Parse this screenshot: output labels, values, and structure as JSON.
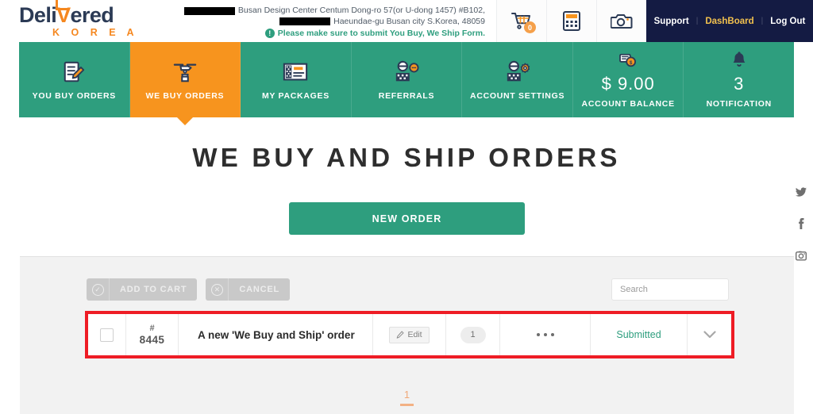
{
  "header": {
    "logo": {
      "text_before": "Deli",
      "text_v": "V",
      "text_after": "ered",
      "subtitle": "K O R E A"
    },
    "address": {
      "line1": "Busan Design Center Centum Dong-ro 57(or U-dong 1457) #B102,",
      "line2": "Haeundae-gu Busan city S.Korea, 48059",
      "notice": "Please make sure to submit You Buy, We Ship Form.",
      "notice_icon": "exclamation-circle-icon"
    },
    "icons": [
      {
        "name": "shopping-cart-icon",
        "badge": "0"
      },
      {
        "name": "calculator-icon",
        "badge": null
      },
      {
        "name": "camera-icon",
        "badge": null
      }
    ],
    "links": [
      {
        "label": "Support",
        "accent": false
      },
      {
        "label": "DashBoard",
        "accent": true
      },
      {
        "label": "Log Out",
        "accent": false
      }
    ],
    "link_separator": "|"
  },
  "nav": {
    "tabs": [
      {
        "label": "YOU BUY ORDERS",
        "icon": "document-pencil-icon",
        "active": false,
        "value": null
      },
      {
        "label": "WE BUY ORDERS",
        "icon": "drone-delivery-icon",
        "active": true,
        "value": null
      },
      {
        "label": "MY PACKAGES",
        "icon": "package-box-icon",
        "active": false,
        "value": null
      },
      {
        "label": "REFERRALS",
        "icon": "person-chat-icon",
        "active": false,
        "value": null
      },
      {
        "label": "ACCOUNT SETTINGS",
        "icon": "person-gear-icon",
        "active": false,
        "value": null
      },
      {
        "label": "ACCOUNT BALANCE",
        "icon": "money-coin-icon",
        "active": false,
        "value": "$ 9.00"
      },
      {
        "label": "NOTIFICATION",
        "icon": "bell-icon",
        "active": false,
        "value": "3"
      }
    ]
  },
  "main": {
    "title": "WE BUY AND SHIP ORDERS",
    "new_order_label": "NEW ORDER",
    "toolbar": {
      "add_to_cart_label": "ADD TO CART",
      "add_to_cart_icon": "check-circle-icon",
      "cancel_label": "CANCEL",
      "cancel_icon": "x-circle-icon"
    },
    "search": {
      "placeholder": "Search",
      "value": "",
      "icon": "search-icon"
    },
    "order_row": {
      "hash_symbol": "#",
      "order_number": "8445",
      "title": "A new 'We Buy and Ship' order",
      "edit_label": "Edit",
      "edit_icon": "pencil-icon",
      "quantity": "1",
      "more_icon": "three-dots-icon",
      "status": "Submitted",
      "expand_icon": "chevron-down-icon"
    },
    "pagination": {
      "current": "1"
    }
  },
  "social": [
    {
      "name": "twitter-icon",
      "glyph": "🐦"
    },
    {
      "name": "facebook-icon",
      "glyph": "f"
    },
    {
      "name": "instagram-icon",
      "glyph": "▣"
    }
  ],
  "colors": {
    "green": "#2e9e7e",
    "orange": "#f7941e",
    "navy": "#141b43",
    "highlight_red": "#ee1c25",
    "gold": "#f2c14e"
  }
}
